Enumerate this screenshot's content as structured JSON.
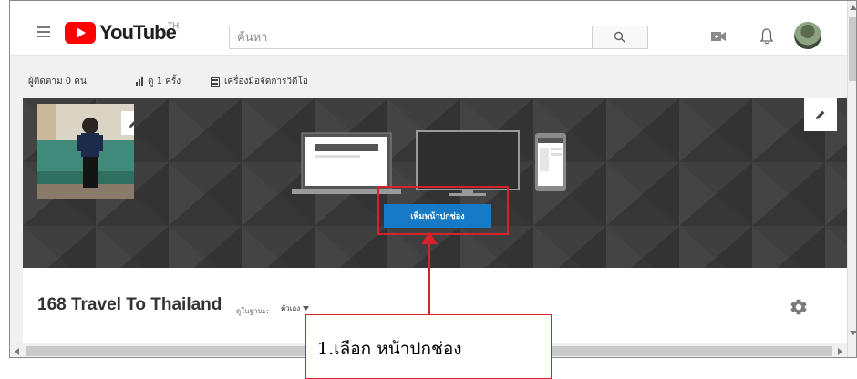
{
  "header": {
    "logo_text": "YouTube",
    "logo_region": "TH",
    "search_placeholder": "ค้นหา",
    "icons": [
      "menu-icon",
      "search-icon",
      "video-camera-icon",
      "bell-icon",
      "avatar"
    ]
  },
  "stats": {
    "subscribers": "ผู้ติดตาม 0 คน",
    "views": "ดู 1 ครั้ง",
    "video_manager": "เครื่องมือจัดการวิดีโอ"
  },
  "banner": {
    "add_channel_art_label": "เพิ่มหน้าปกช่อง"
  },
  "channel": {
    "name": "168 Travel To Thailand",
    "view_as_label": "ดูในฐานะ:",
    "view_as_value": "ตัวเอง"
  },
  "annotation": {
    "text": "1.เลือก หน้าปกช่อง",
    "color": "#d8212b"
  },
  "colors": {
    "youtube_red": "#ff0000",
    "button_blue": "#167ac6",
    "banner_dark": "#3b3b3b"
  }
}
